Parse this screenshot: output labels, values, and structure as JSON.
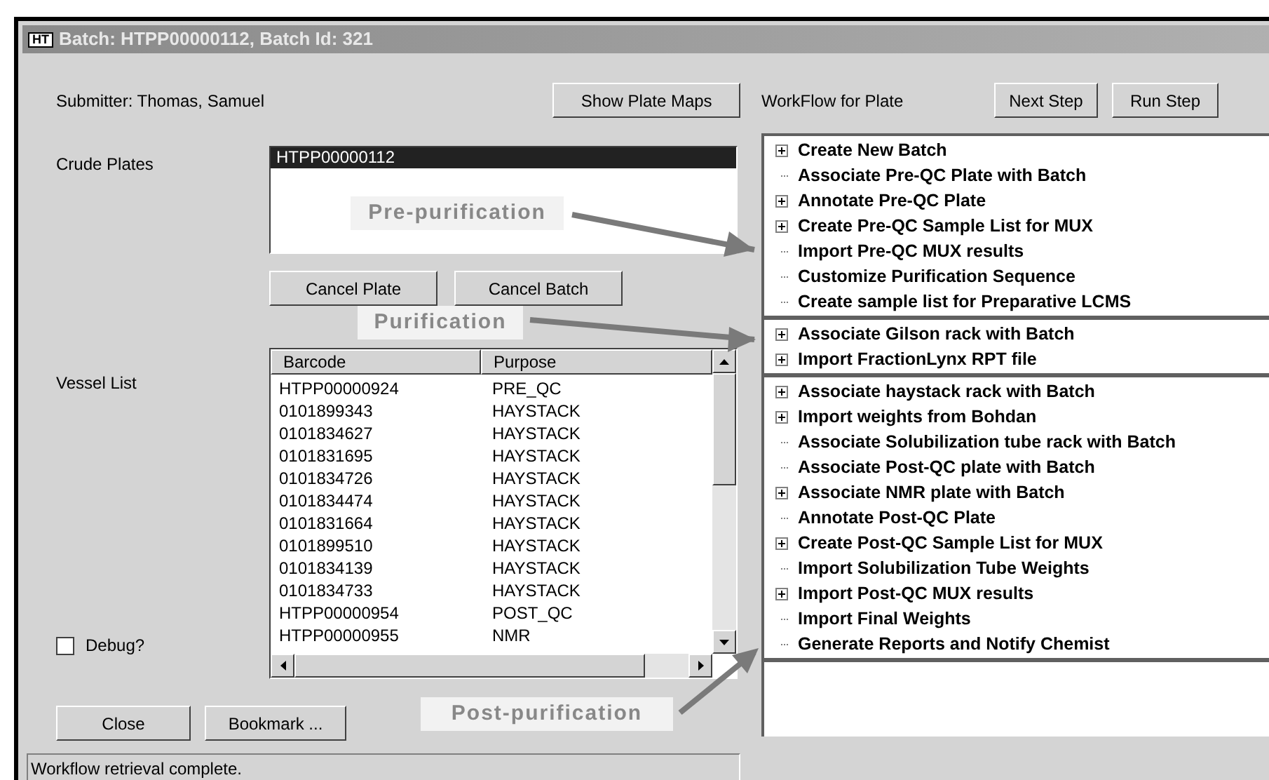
{
  "window": {
    "title": "Batch: HTPP00000112, Batch Id: 321",
    "icon_text": "HT"
  },
  "submitter": "Submitter: Thomas, Samuel",
  "show_plate_maps_button": "Show Plate Maps",
  "crude_plates": {
    "label": "Crude Plates",
    "items": [
      {
        "text": "HTPP00000112",
        "selected": true
      }
    ]
  },
  "plate_buttons": [
    "Cancel Plate",
    "Cancel Batch"
  ],
  "vessel_list": {
    "label": "Vessel List",
    "columns": [
      "Barcode",
      "Purpose"
    ],
    "rows": [
      [
        "HTPP00000924",
        "PRE_QC"
      ],
      [
        "0101899343",
        "HAYSTACK"
      ],
      [
        "0101834627",
        "HAYSTACK"
      ],
      [
        "0101831695",
        "HAYSTACK"
      ],
      [
        "0101834726",
        "HAYSTACK"
      ],
      [
        "0101834474",
        "HAYSTACK"
      ],
      [
        "0101831664",
        "HAYSTACK"
      ],
      [
        "0101899510",
        "HAYSTACK"
      ],
      [
        "0101834139",
        "HAYSTACK"
      ],
      [
        "0101834733",
        "HAYSTACK"
      ],
      [
        "HTPP00000954",
        "POST_QC"
      ],
      [
        "HTPP00000955",
        "NMR"
      ]
    ]
  },
  "debug": {
    "label": "Debug?",
    "checked": false
  },
  "bottom_buttons": [
    "Close",
    "Bookmark ..."
  ],
  "status_bar": "Workflow retrieval complete.",
  "workflow": {
    "label": "WorkFlow for Plate",
    "buttons": [
      "Next Step",
      "Run Step"
    ],
    "groups": [
      {
        "items": [
          {
            "label": "Create New Batch",
            "expandable": true
          },
          {
            "label": "Associate Pre-QC Plate with Batch",
            "expandable": false
          },
          {
            "label": "Annotate Pre-QC Plate",
            "expandable": true
          },
          {
            "label": "Create Pre-QC Sample List for MUX",
            "expandable": true
          },
          {
            "label": "Import Pre-QC MUX results",
            "expandable": false
          },
          {
            "label": "Customize Purification Sequence",
            "expandable": false
          },
          {
            "label": "Create sample list for Preparative LCMS",
            "expandable": false
          }
        ]
      },
      {
        "items": [
          {
            "label": "Associate Gilson rack with Batch",
            "expandable": true
          },
          {
            "label": "Import FractionLynx RPT file",
            "expandable": true
          }
        ]
      },
      {
        "items": [
          {
            "label": "Associate haystack rack with Batch",
            "expandable": true
          },
          {
            "label": "Import weights from Bohdan",
            "expandable": true
          },
          {
            "label": "Associate Solubilization tube rack with Batch",
            "expandable": false
          },
          {
            "label": "Associate Post-QC plate with Batch",
            "expandable": false
          },
          {
            "label": "Associate NMR plate with Batch",
            "expandable": true
          },
          {
            "label": "Annotate Post-QC Plate",
            "expandable": false
          },
          {
            "label": "Create Post-QC Sample List for MUX",
            "expandable": true
          },
          {
            "label": "Import Solubilization Tube Weights",
            "expandable": false
          },
          {
            "label": "Import Post-QC MUX results",
            "expandable": true
          },
          {
            "label": "Import Final Weights",
            "expandable": false
          },
          {
            "label": "Generate Reports and Notify Chemist",
            "expandable": false
          }
        ]
      }
    ]
  },
  "annotations": [
    {
      "label": "Pre-purification"
    },
    {
      "label": "Purification"
    },
    {
      "label": "Post-purification"
    }
  ]
}
